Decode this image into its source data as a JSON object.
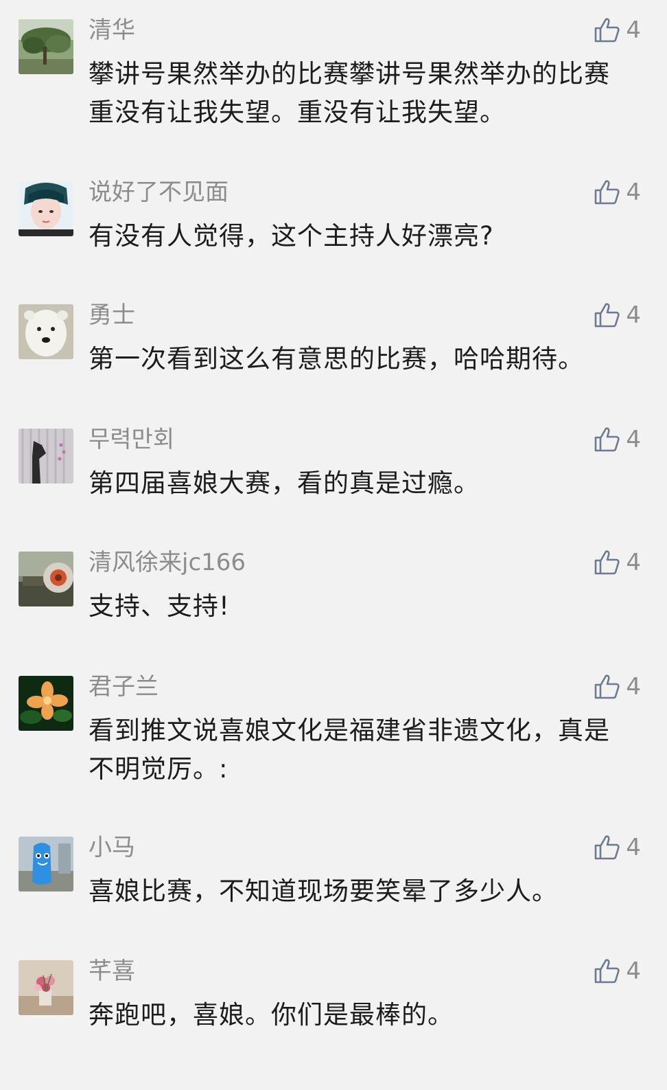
{
  "comments": [
    {
      "nickname": "清华",
      "likes": "4",
      "text": "攀讲号果然举办的比赛攀讲号果然举办的比赛重没有让我失望。重没有让我失望。"
    },
    {
      "nickname": "说好了不见面",
      "likes": "4",
      "text": "有没有人觉得，这个主持人好漂亮?"
    },
    {
      "nickname": "勇士",
      "likes": "4",
      "text": "第一次看到这么有意思的比赛，哈哈期待。"
    },
    {
      "nickname": "무력만회",
      "likes": "4",
      "text": "第四届喜娘大赛，看的真是过瘾。"
    },
    {
      "nickname": "清风徐来jc166",
      "likes": "4",
      "text": "支持、支持!"
    },
    {
      "nickname": "君子兰",
      "likes": "4",
      "text": "看到推文说喜娘文化是福建省非遗文化，真是不明觉厉。:"
    },
    {
      "nickname": "小马",
      "likes": "4",
      "text": "喜娘比赛，不知道现场要笑晕了多少人。"
    },
    {
      "nickname": "芊喜",
      "likes": "4",
      "text": "奔跑吧，喜娘。你们是最棒的。"
    }
  ],
  "icons": {
    "like": "thumbs-up-outline-icon"
  },
  "colors": {
    "background": "#f2f2f2",
    "nickname": "#8c8c8c",
    "text": "#1c1c1c",
    "like_icon": "#6b7a8f"
  }
}
